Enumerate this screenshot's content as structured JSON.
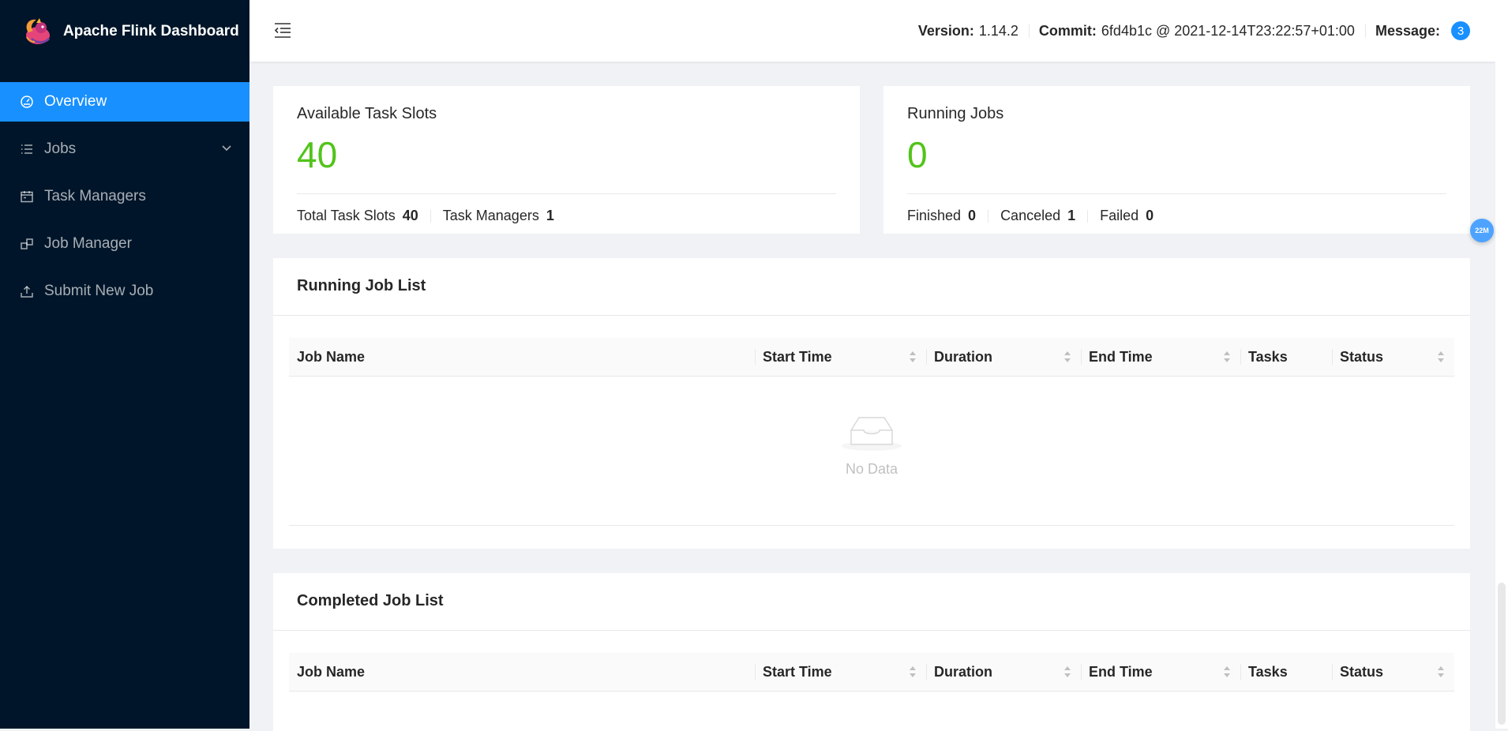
{
  "brand": {
    "name": "Apache Flink Dashboard"
  },
  "sidebar": {
    "items": [
      {
        "label": "Overview",
        "icon": "dashboard-icon"
      },
      {
        "label": "Jobs",
        "icon": "list-icon"
      },
      {
        "label": "Task Managers",
        "icon": "schedule-icon"
      },
      {
        "label": "Job Manager",
        "icon": "build-icon"
      },
      {
        "label": "Submit New Job",
        "icon": "upload-icon"
      }
    ]
  },
  "header": {
    "version_label": "Version:",
    "version": "1.14.2",
    "commit_label": "Commit:",
    "commit": "6fd4b1c @ 2021-12-14T23:22:57+01:00",
    "message_label": "Message:",
    "message_count": "3"
  },
  "slots": {
    "title": "Available Task Slots",
    "value": "40",
    "total_label": "Total Task Slots",
    "total_value": "40",
    "tm_label": "Task Managers",
    "tm_value": "1"
  },
  "jobs": {
    "title": "Running Jobs",
    "value": "0",
    "finished_label": "Finished",
    "finished_value": "0",
    "canceled_label": "Canceled",
    "canceled_value": "1",
    "failed_label": "Failed",
    "failed_value": "0"
  },
  "running_list": {
    "title": "Running Job List",
    "columns": [
      "Job Name",
      "Start Time",
      "Duration",
      "End Time",
      "Tasks",
      "Status"
    ],
    "empty_text": "No Data"
  },
  "completed_list": {
    "title": "Completed Job List",
    "columns": [
      "Job Name",
      "Start Time",
      "Duration",
      "End Time",
      "Tasks",
      "Status"
    ]
  },
  "float_badge": "22M",
  "colors": {
    "sidebar_bg": "#001529",
    "accent": "#1890ff",
    "success": "#52c41a"
  }
}
